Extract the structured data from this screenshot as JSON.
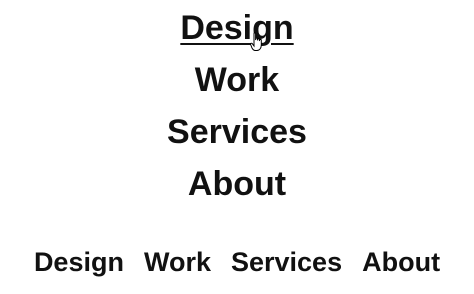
{
  "vertical_nav": {
    "items": [
      {
        "label": "Design",
        "state": "hover"
      },
      {
        "label": "Work"
      },
      {
        "label": "Services"
      },
      {
        "label": "About"
      }
    ]
  },
  "horizontal_nav": {
    "items": [
      {
        "label": "Design"
      },
      {
        "label": "Work"
      },
      {
        "label": "Services"
      },
      {
        "label": "About"
      }
    ]
  },
  "cursor": {
    "icon": "hand-pointer-icon"
  }
}
